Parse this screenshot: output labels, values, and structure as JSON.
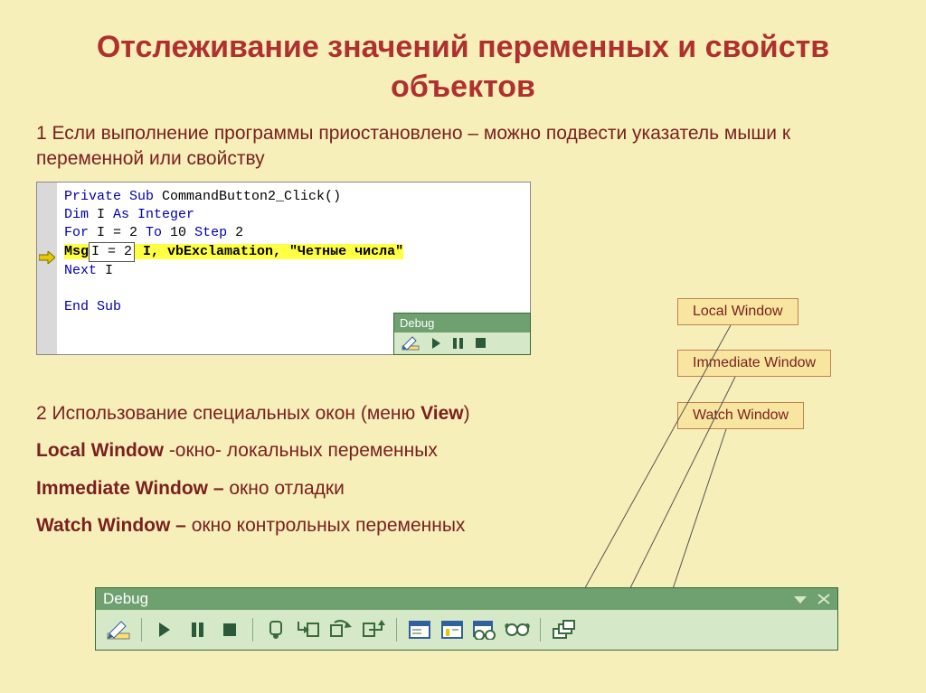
{
  "title": "Отслеживание значений переменных и свойств объектов",
  "para1": "1 Если выполнение программы приостановлено – можно подвести указатель мыши к переменной или свойству",
  "code": {
    "l1a": "Private Sub",
    "l1b": " CommandButton2_Click()",
    "l2a": "Dim",
    "l2b": " I ",
    "l2c": "As Integer",
    "l3a": "For",
    "l3b": " I = 2 ",
    "l3c": "To",
    "l3d": " 10 ",
    "l3e": "Step",
    "l3f": " 2",
    "l4a": "Msg",
    "tooltip": "I = 2",
    "l4b": " I, vbExclamation, \"Четные числа\"",
    "l5a": "Next",
    "l5b": " I",
    "l6a": "End Sub"
  },
  "small_tb": {
    "title": "Debug"
  },
  "labels": {
    "local": "Local Window",
    "immediate": "Immediate Window",
    "watch": "Watch Window"
  },
  "section2": {
    "l1a": "2 Использование специальных окон (меню ",
    "l1b": "View",
    "l1c": ")",
    "l2a": "Local Window",
    "l2b": " -окно- локальных переменных",
    "l3a": "Immediate Window –",
    "l3b": " окно отладки",
    "l4a": "Watch Window –",
    "l4b": " окно контрольных переменных"
  },
  "big_tb": {
    "title": "Debug"
  }
}
